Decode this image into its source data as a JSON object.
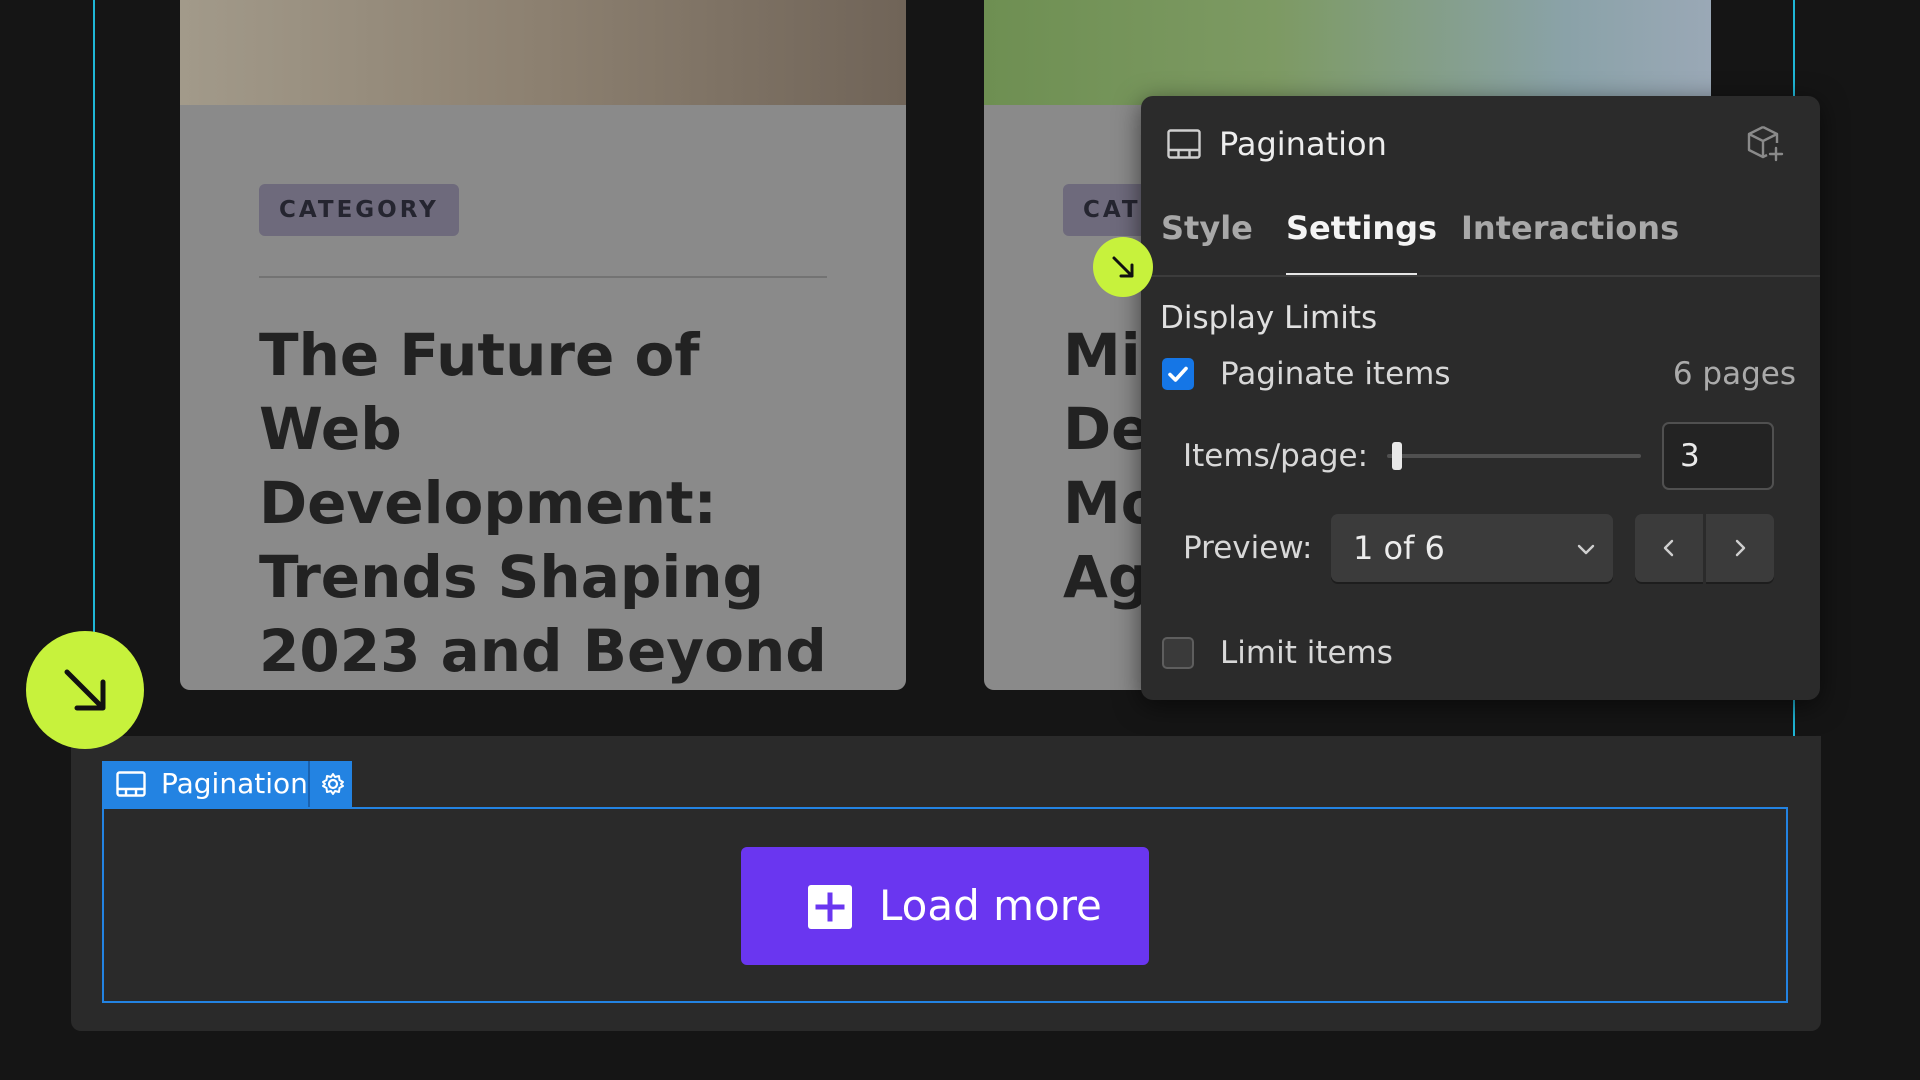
{
  "cards": [
    {
      "category": "CATEGORY",
      "title": "The Future of Web Development: Trends Shaping 2023 and Beyond"
    },
    {
      "category": "CAT",
      "title": "Mi De Mo Ag"
    }
  ],
  "panel": {
    "title": "Pagination",
    "tabs": [
      "Style",
      "Settings",
      "Interactions"
    ],
    "active_tab": "Settings",
    "section_label": "Display Limits",
    "paginate": {
      "label": "Paginate items",
      "checked": true,
      "pages": "6 pages"
    },
    "items_per_page": {
      "label": "Items/page:",
      "value": "3",
      "slider_fraction": 0.02
    },
    "preview": {
      "label": "Preview:",
      "value": "1 of 6"
    },
    "limit": {
      "label": "Limit items",
      "checked": false
    }
  },
  "element_tag": {
    "label": "Pagination"
  },
  "load_more": {
    "label": "Load more"
  },
  "colors": {
    "accent_purple": "#6a36f0",
    "selection_blue": "#2383e2",
    "collection_cyan": "#1fb6d6",
    "marker_green": "#c7f23c",
    "checkbox_blue": "#1576e6"
  },
  "icons": {
    "panel": "pagination-icon",
    "component": "component-add-icon",
    "chevron": "chevron-down-icon",
    "prev": "chevron-left-icon",
    "next": "chevron-right-icon",
    "gear": "gear-icon",
    "plus": "plus-icon",
    "marker": "arrow-down-right-icon"
  }
}
